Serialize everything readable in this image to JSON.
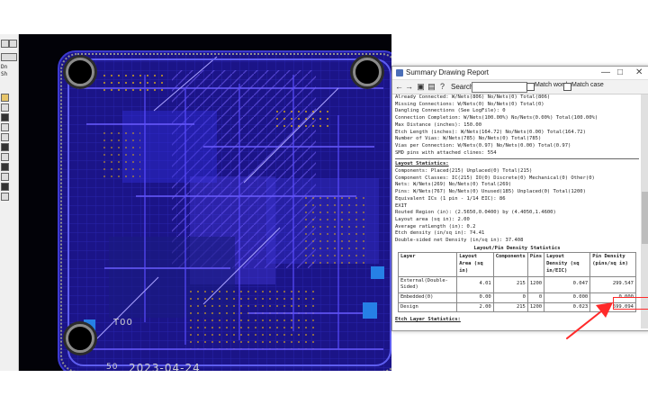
{
  "left_toolbar": {
    "codes": [
      "Dn",
      "Sh"
    ]
  },
  "board": {
    "date_label": "2023-04-24",
    "small_labels": [
      "T00",
      "50"
    ]
  },
  "dialog": {
    "title": "Summary Drawing Report",
    "search_label": "Search:",
    "search_value": "",
    "match_word_label": "Match word",
    "match_case_label": "Match case",
    "connection_lines": [
      "Already Connected: W/Nets(806) No/Nets(0) Total(806)",
      "Missing Connections: W/Nets(0) No/Nets(0) Total(0)",
      "Dangling Connections (See LogFile): 0",
      "Connection Completion: W/Nets(100.00%) No/Nets(0.00%) Total(100.00%)",
      "Max Distance (inches): 150.00",
      "Etch Length (inches): W/Nets(164.72) No/Nets(0.00) Total(164.72)",
      "Number of Vias: W/Nets(785) No/Nets(0) Total(785)",
      "Vias per Connection: W/Nets(0.97) No/Nets(0.00) Total(0.97)",
      "SMD pins with attached clines: 554"
    ],
    "layout_heading": "Layout Statistics:",
    "layout_lines": [
      "Components: Placed(215) Unplaced(0) Total(215)",
      "Component Classes: IC(215) IO(0) Discrete(0) Mechanical(0) Other(0)",
      "Nets: W/Nets(269) No/Nets(0) Total(269)",
      "Pins: W/Nets(767) No/Nets(0) Unused(185) Unplaced(0) Total(1200)",
      "Equivalent ICs (1 pin - 1/14 EIC): 86",
      "EXIT",
      "Routed Region (in): (2.5650,0.0400) by (4.4050,1.4600)",
      "Layout area (sq in): 2.00",
      "Average ratLength (in): 0.2",
      "Etch density (in/sq in): 74.41",
      "Double-sided net Density (in/sq in): 37.408"
    ],
    "density_title": "Layout/Pin Density Statistics",
    "table": {
      "headers": [
        "Layer",
        "Layout Area (sq in)",
        "Components",
        "Pins",
        "Layout Density (sq in/EIC)",
        "Pin Density (pins/sq in)"
      ],
      "rows": [
        [
          "External(Double-Sided)",
          "4.01",
          "215",
          "1200",
          "0.047",
          "299.547"
        ],
        [
          "Embedded(0)",
          "0.00",
          "0",
          "0",
          "0.000",
          "0.000"
        ],
        [
          "Design",
          "2.00",
          "215",
          "1200",
          "0.023",
          "599.094"
        ]
      ]
    },
    "etch_heading": "Etch Layer Statistics:"
  },
  "colors": {
    "board_blue": "#1b1488",
    "trace_blue": "#5a4cff",
    "arrow_red": "#ff2a2a"
  }
}
